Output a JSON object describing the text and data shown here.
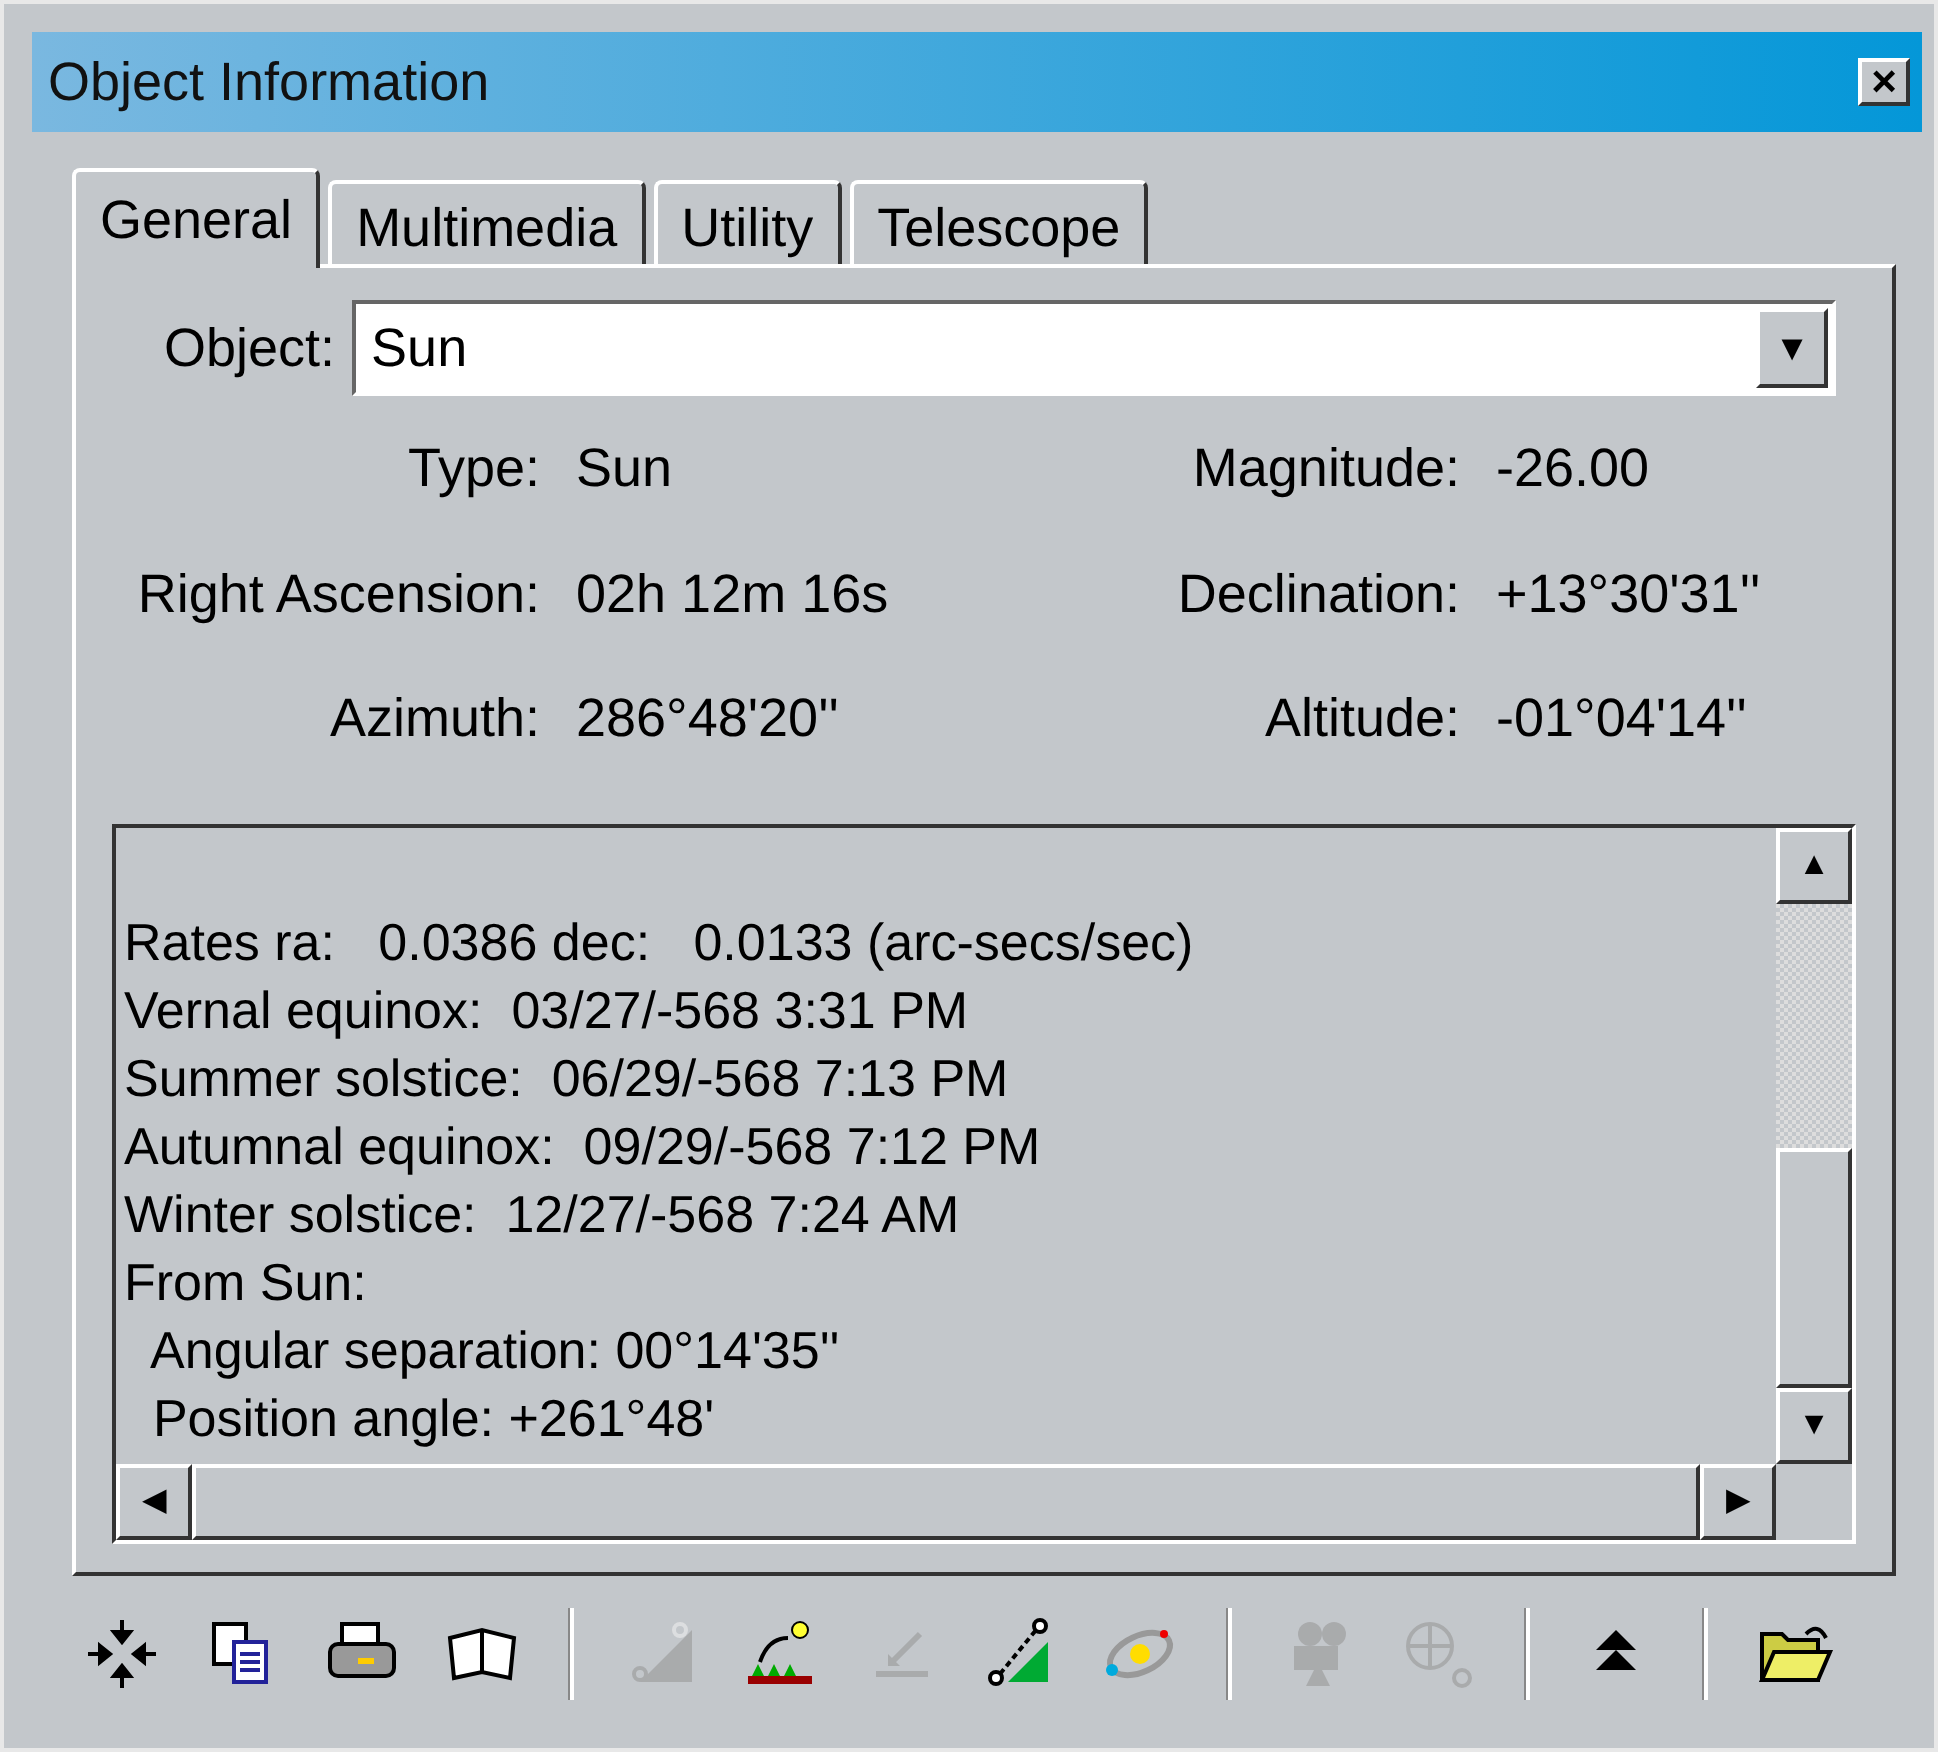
{
  "window": {
    "title": "Object Information",
    "close": "×"
  },
  "tabs": [
    {
      "label": "General",
      "selected": true
    },
    {
      "label": "Multimedia",
      "selected": false
    },
    {
      "label": "Utility",
      "selected": false
    },
    {
      "label": "Telescope",
      "selected": false
    }
  ],
  "object_field": {
    "label": "Object:",
    "value": "Sun",
    "arrow": "▼"
  },
  "properties": [
    {
      "label": "Type:",
      "value": "Sun"
    },
    {
      "label": "Magnitude:",
      "value": "-26.00"
    },
    {
      "label": "Right Ascension:",
      "value": "02h 12m 16s"
    },
    {
      "label": "Declination:",
      "value": "+13°30'31''"
    },
    {
      "label": "Azimuth:",
      "value": "286°48'20''"
    },
    {
      "label": "Altitude:",
      "value": "-01°04'14''"
    }
  ],
  "details": [
    "Rates ra:   0.0386 dec:   0.0133 (arc-secs/sec)",
    "Vernal equinox:  03/27/-568 3:31 PM",
    "Summer solstice:  06/29/-568 7:13 PM",
    "Autumnal equinox:  09/29/-568 7:12 PM",
    "Winter solstice:  12/27/-568 7:24 AM",
    "From Sun:",
    "  Angular separation: 00°14'35''",
    "  Position angle: +261°48'"
  ],
  "scroll_arrows": {
    "up": "▲",
    "down": "▼",
    "left": "◀",
    "right": "▶"
  },
  "toolbar": [
    {
      "kind": "button",
      "disabled": false
    },
    {
      "kind": "button",
      "disabled": false
    },
    {
      "kind": "button",
      "disabled": false
    },
    {
      "kind": "button",
      "disabled": false
    },
    {
      "kind": "separator"
    },
    {
      "kind": "button",
      "disabled": true
    },
    {
      "kind": "button",
      "disabled": false
    },
    {
      "kind": "button",
      "disabled": true
    },
    {
      "kind": "button",
      "disabled": false
    },
    {
      "kind": "button",
      "disabled": false
    },
    {
      "kind": "separator"
    },
    {
      "kind": "button",
      "disabled": true
    },
    {
      "kind": "button",
      "disabled": true
    },
    {
      "kind": "separator"
    },
    {
      "kind": "button",
      "disabled": false
    },
    {
      "kind": "separator"
    },
    {
      "kind": "button",
      "disabled": false
    }
  ]
}
